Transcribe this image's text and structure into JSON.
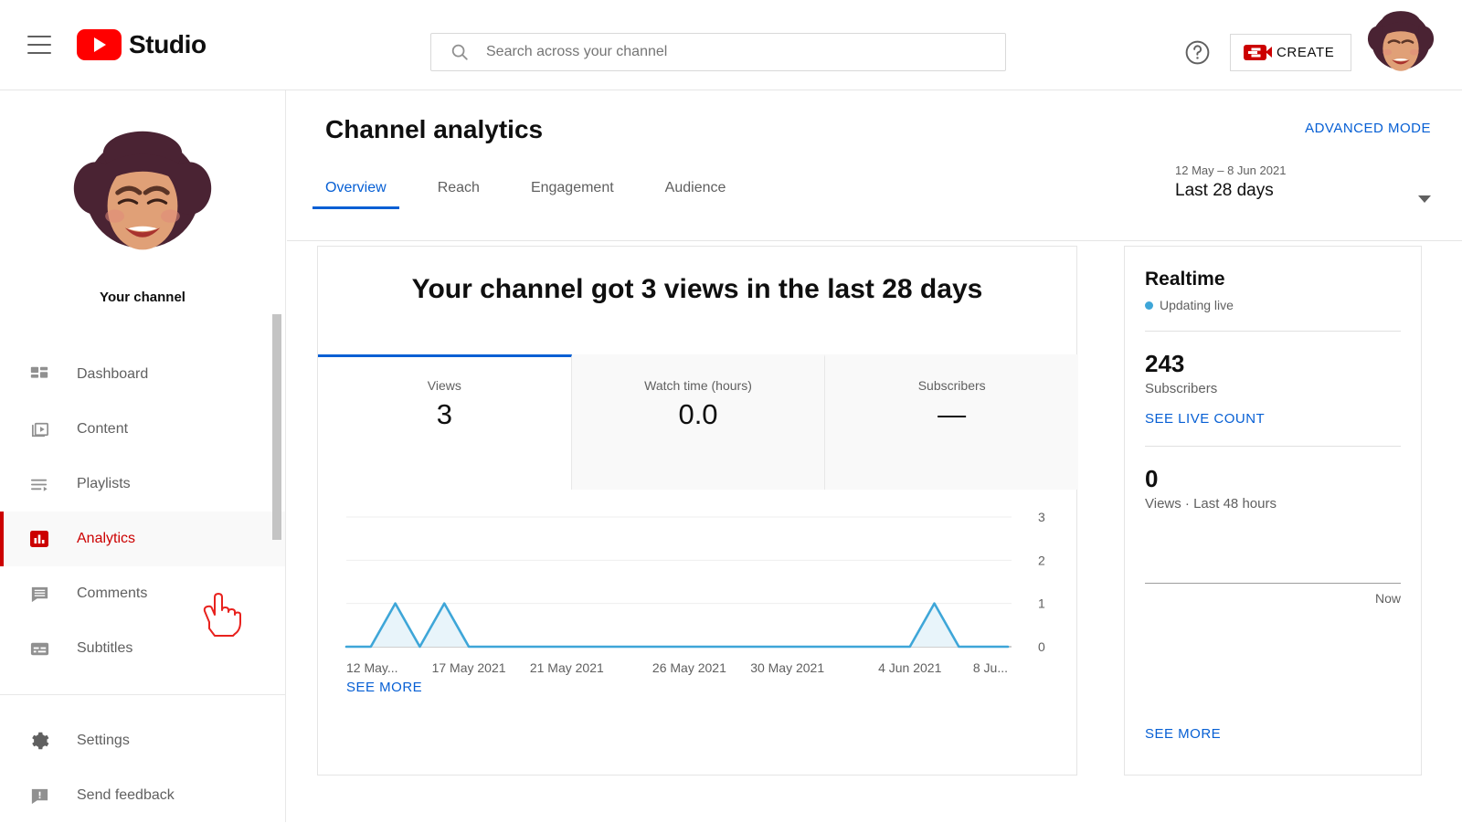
{
  "topbar": {
    "menu_icon": "hamburger-menu-icon",
    "brand": "Studio",
    "logo_color": "#ff0000",
    "search_placeholder": "Search across your channel",
    "search_value": "",
    "help_icon": "help-circle-icon",
    "create_label": "CREATE",
    "create_icon": "video-camera-plus-icon",
    "avatar": "user-avatar"
  },
  "sidebar": {
    "channel_name": "Your channel",
    "avatar": "channel-avatar",
    "items": [
      {
        "label": "Dashboard",
        "icon": "dashboard-icon",
        "active": false
      },
      {
        "label": "Content",
        "icon": "content-video-icon",
        "active": false
      },
      {
        "label": "Playlists",
        "icon": "playlists-icon",
        "active": false
      },
      {
        "label": "Analytics",
        "icon": "analytics-bar-icon",
        "active": true
      },
      {
        "label": "Comments",
        "icon": "comments-icon",
        "active": false
      },
      {
        "label": "Subtitles",
        "icon": "subtitles-icon",
        "active": false
      }
    ],
    "footer_items": [
      {
        "label": "Settings",
        "icon": "gear-icon"
      },
      {
        "label": "Send feedback",
        "icon": "feedback-icon"
      }
    ],
    "active_color": "#cc0000"
  },
  "header": {
    "title": "Channel analytics",
    "advanced_mode": "ADVANCED MODE",
    "date_range_sub": "12 May – 8 Jun 2021",
    "date_range_main": "Last 28 days",
    "accent_color": "#065fd4"
  },
  "tabs": [
    {
      "label": "Overview",
      "active": true
    },
    {
      "label": "Reach",
      "active": false
    },
    {
      "label": "Engagement",
      "active": false
    },
    {
      "label": "Audience",
      "active": false
    }
  ],
  "overview": {
    "headline": "Your channel got 3 views in the last 28 days",
    "metrics": [
      {
        "label": "Views",
        "value": "3",
        "active": true
      },
      {
        "label": "Watch time (hours)",
        "value": "0.0",
        "active": false
      },
      {
        "label": "Subscribers",
        "value": "—",
        "active": false
      }
    ],
    "see_more": "SEE MORE"
  },
  "chart_data": {
    "type": "area",
    "title": "Views over time",
    "xlabel": "",
    "ylabel": "Views",
    "ylim": [
      0,
      3
    ],
    "yticks": [
      "0",
      "1",
      "2",
      "3"
    ],
    "grid": true,
    "legend": "none",
    "line_color": "#3ea6d8",
    "fill_color": "#e8f4fa",
    "xtick_labels": [
      "12 May...",
      "17 May 2021",
      "21 May 2021",
      "26 May 2021",
      "30 May 2021",
      "4 Jun 2021",
      "8 Ju..."
    ],
    "x": [
      "12 May",
      "13 May",
      "14 May",
      "15 May",
      "16 May",
      "17 May",
      "18 May",
      "19 May",
      "20 May",
      "21 May",
      "22 May",
      "23 May",
      "24 May",
      "25 May",
      "26 May",
      "27 May",
      "28 May",
      "29 May",
      "30 May",
      "31 May",
      "1 Jun",
      "2 Jun",
      "3 Jun",
      "4 Jun",
      "5 Jun",
      "6 Jun",
      "7 Jun",
      "8 Jun"
    ],
    "values": [
      0,
      0,
      1,
      0,
      1,
      0,
      0,
      0,
      0,
      0,
      0,
      0,
      0,
      0,
      0,
      0,
      0,
      0,
      0,
      0,
      0,
      0,
      0,
      0,
      1,
      0,
      0,
      0
    ]
  },
  "realtime": {
    "title": "Realtime",
    "live_status": "Updating live",
    "live_dot_color": "#3ea6d8",
    "subscribers_value": "243",
    "subscribers_label": "Subscribers",
    "see_live_count": "SEE LIVE COUNT",
    "views_value": "0",
    "views_label": "Views · Last 48 hours",
    "now_label": "Now",
    "see_more": "SEE MORE"
  }
}
